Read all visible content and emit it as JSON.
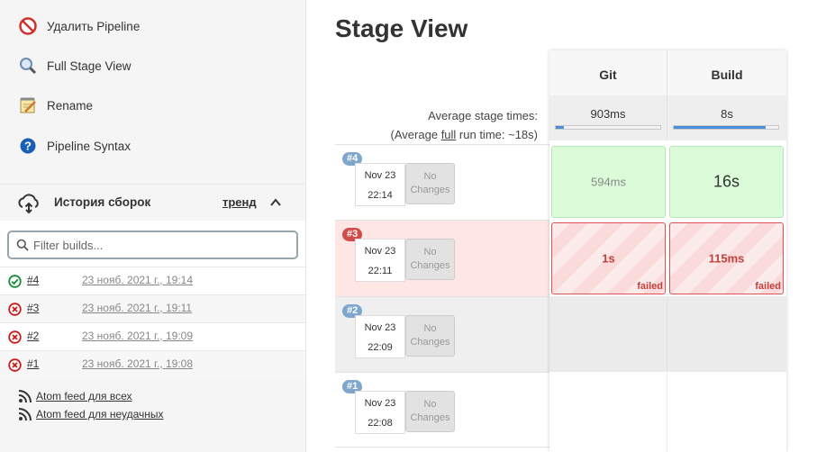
{
  "sidebar": {
    "tasks": [
      {
        "label": "Удалить Pipeline",
        "icon": "no-entry-icon"
      },
      {
        "label": "Full Stage View",
        "icon": "magnifier-icon"
      },
      {
        "label": "Rename",
        "icon": "notepad-pencil-icon"
      },
      {
        "label": "Pipeline Syntax",
        "icon": "help-icon"
      }
    ],
    "history": {
      "title": "История сборок",
      "trend_label": "тренд",
      "filter_placeholder": "Filter builds...",
      "builds": [
        {
          "number": "#4",
          "date": "23 нояб. 2021 г., 19:14",
          "status": "success"
        },
        {
          "number": "#3",
          "date": "23 нояб. 2021 г., 19:11",
          "status": "failed"
        },
        {
          "number": "#2",
          "date": "23 нояб. 2021 г., 19:09",
          "status": "failed"
        },
        {
          "number": "#1",
          "date": "23 нояб. 2021 г., 19:08",
          "status": "failed"
        }
      ]
    },
    "feeds": [
      "Atom feed для всех",
      "Atom feed для неудачных"
    ]
  },
  "stage_view": {
    "title": "Stage View",
    "avg_stage_times_label": "Average stage times:",
    "avg_run_prefix": "(Average ",
    "avg_run_link": "full",
    "avg_run_suffix": " run time: ~18s)",
    "stages": [
      {
        "name": "Git",
        "avg": "903ms",
        "avg_fraction": 0.08
      },
      {
        "name": "Build",
        "avg": "8s",
        "avg_fraction": 0.88
      }
    ],
    "no_changes_line1": "No",
    "no_changes_line2": "Changes",
    "runs": [
      {
        "badge": "#4",
        "date": "Nov 23",
        "time": "22:14",
        "state": "success",
        "cells": [
          {
            "text": "594ms",
            "state": "success"
          },
          {
            "text": "16s",
            "state": "success"
          }
        ]
      },
      {
        "badge": "#3",
        "date": "Nov 23",
        "time": "22:11",
        "state": "failed",
        "cells": [
          {
            "text": "1s",
            "state": "failed",
            "flag": "failed"
          },
          {
            "text": "115ms",
            "state": "failed",
            "flag": "failed"
          }
        ]
      },
      {
        "badge": "#2",
        "date": "Nov 23",
        "time": "22:09",
        "state": "not-run",
        "cells": []
      },
      {
        "badge": "#1",
        "date": "Nov 23",
        "time": "22:08",
        "state": "not-run",
        "cells": []
      }
    ]
  },
  "colors": {
    "success_cell": "#dbfbd9",
    "failed_cell": "#fadada",
    "failed_text": "#c43f3b",
    "badge_blue": "#7fa6cc",
    "badge_red": "#d24a4a",
    "progress": "#4b8edc"
  }
}
